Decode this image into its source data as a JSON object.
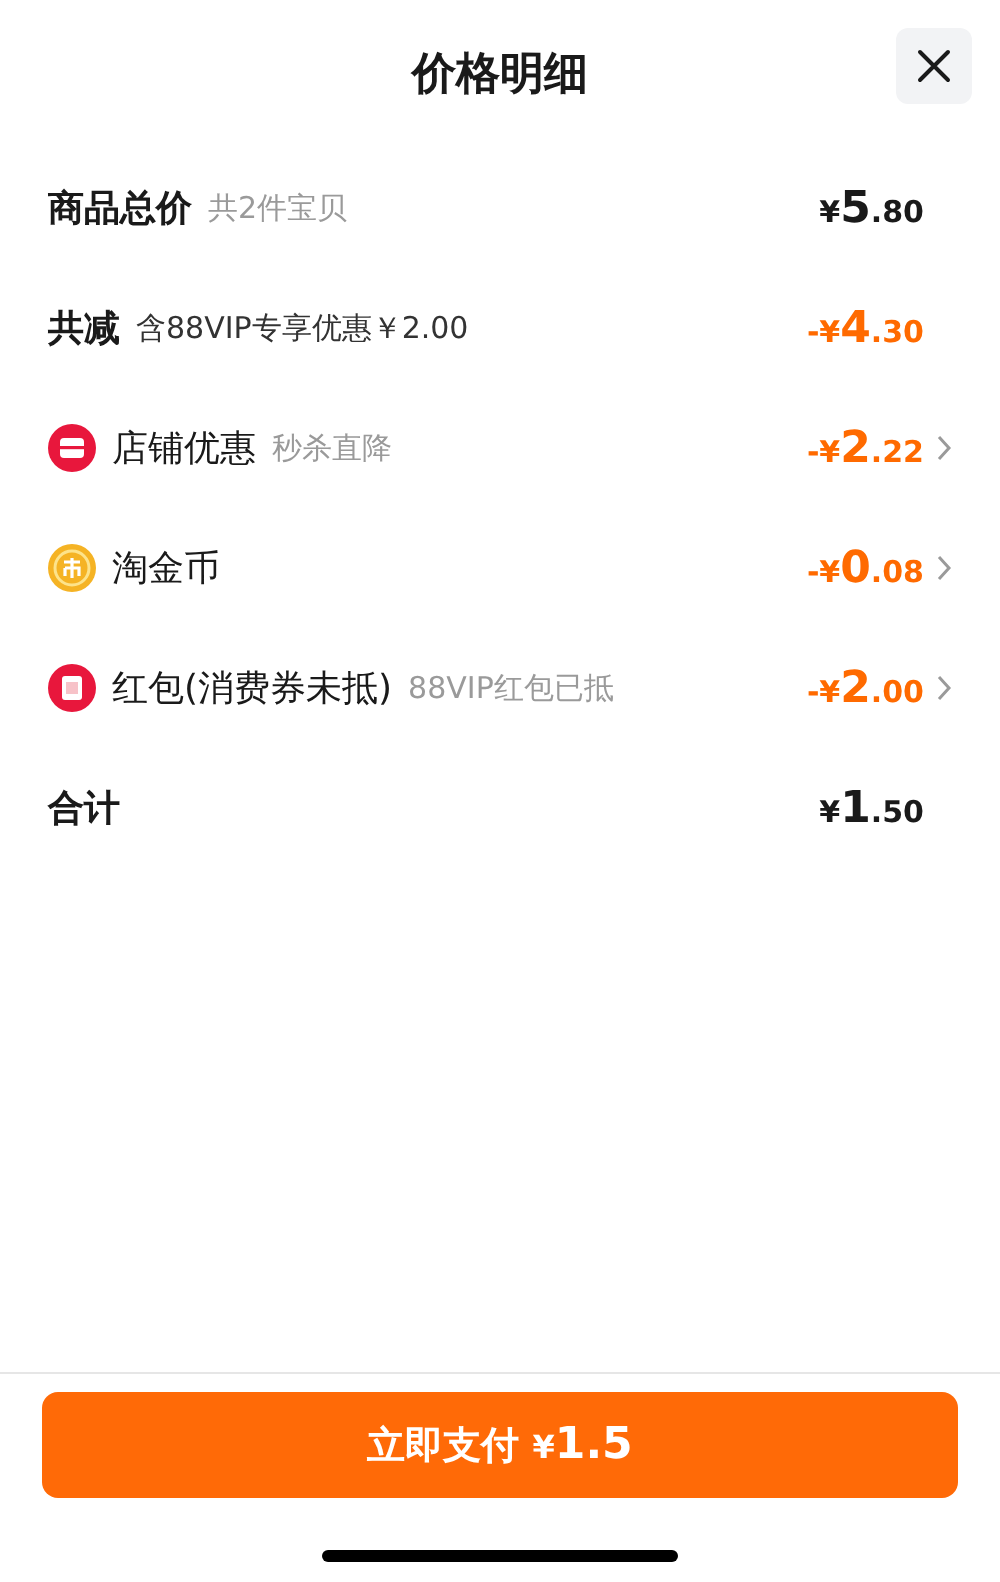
{
  "title": "价格明细",
  "rows": [
    {
      "kind": "plain",
      "label": "商品总价",
      "note": "共2件宝贝",
      "price": {
        "sign": "¥",
        "whole": "5",
        "fraction": ".80"
      },
      "color": "#1a1a1a",
      "arrow": false
    },
    {
      "kind": "plain",
      "label": "共减",
      "note": "含88VIP专享优惠￥2.00",
      "price": {
        "sign": "-¥",
        "whole": "4",
        "fraction": ".30"
      },
      "color": "#ff6a00",
      "arrow": false
    },
    {
      "kind": "shop",
      "label": "店铺优惠",
      "note": "秒杀直降",
      "price": {
        "sign": "-¥",
        "whole": "2",
        "fraction": ".22"
      },
      "color": "#ff6a00",
      "arrow": true
    },
    {
      "kind": "coin",
      "label": "淘金币",
      "price": {
        "sign": "-¥",
        "whole": "0",
        "fraction": ".08"
      },
      "color": "#ff6a00",
      "arrow": true
    },
    {
      "kind": "packet",
      "label": "红包(消费券未抵)",
      "note": "88VIP红包已抵",
      "price": {
        "sign": "-¥",
        "whole": "2",
        "fraction": ".00"
      },
      "color": "#ff6a00",
      "arrow": true
    },
    {
      "kind": "plain",
      "label": "合计",
      "price": {
        "sign": "¥",
        "whole": "1",
        "fraction": ".50"
      },
      "color": "#1a1a1a",
      "arrow": false
    }
  ],
  "pay_button": {
    "label": "立即支付",
    "sign": "¥",
    "amount": "1.5"
  }
}
